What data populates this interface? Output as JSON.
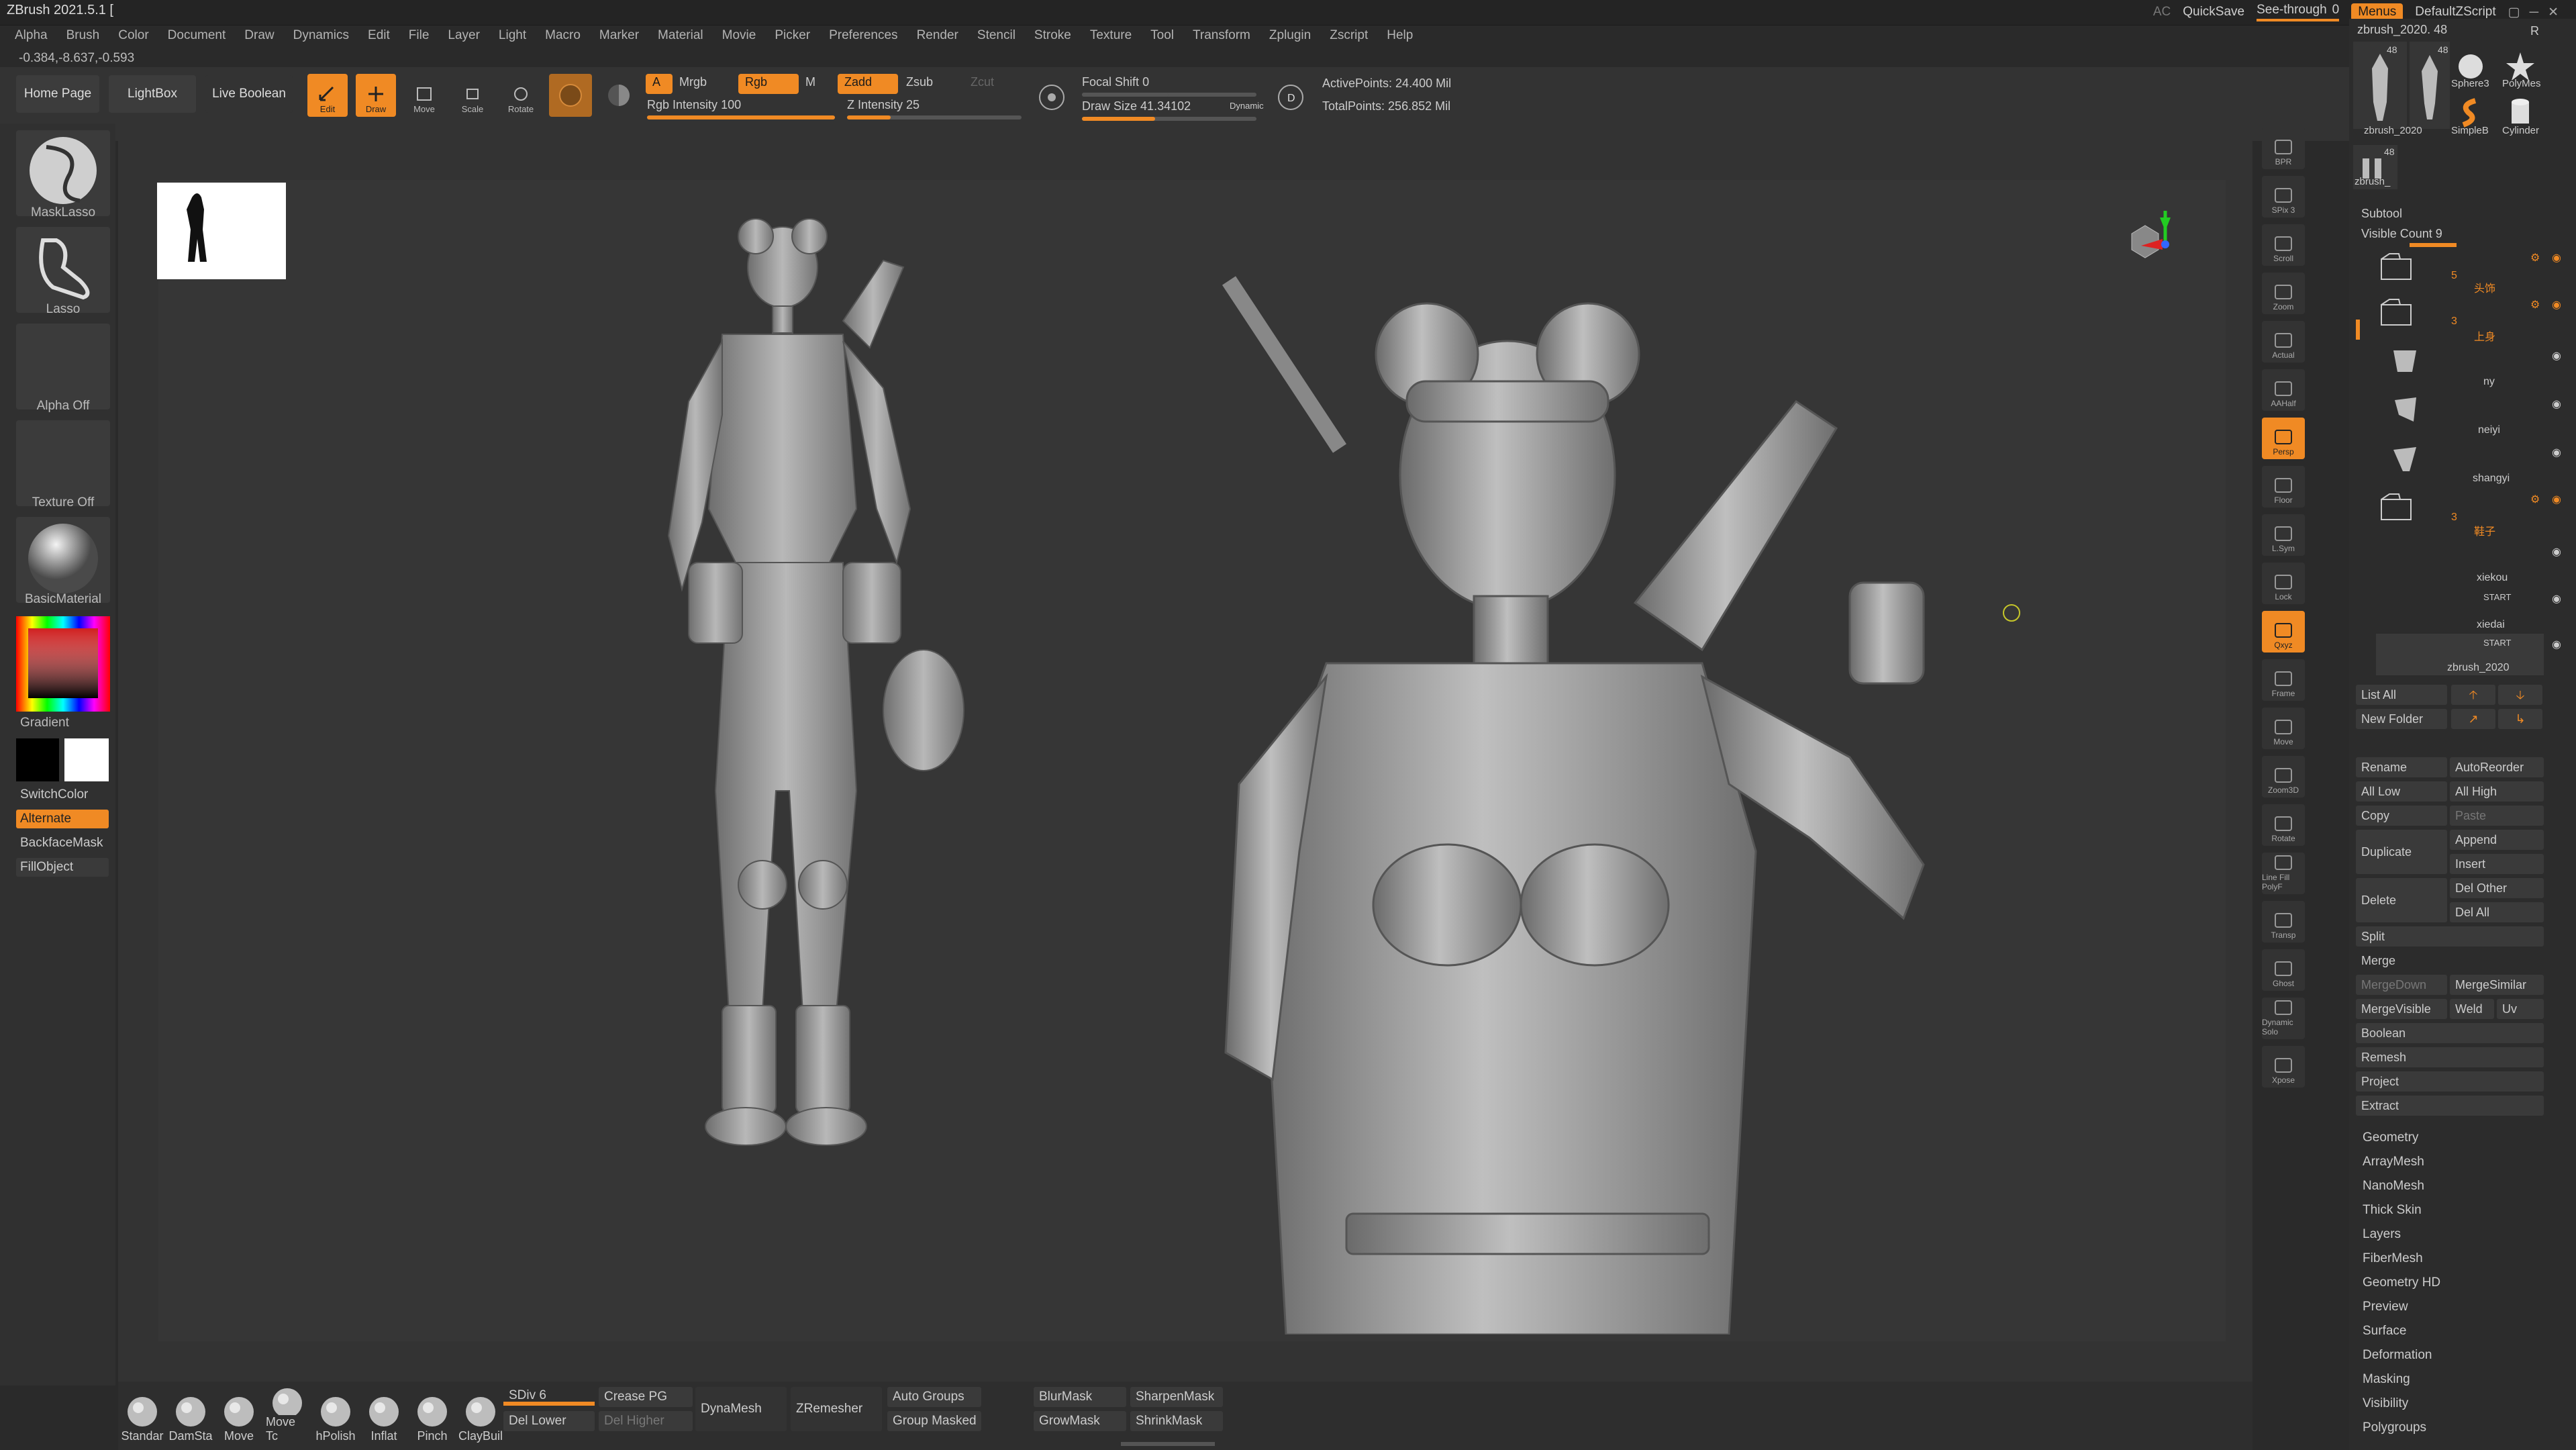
{
  "app": {
    "title": "ZBrush 2021.5.1 [",
    "coords": "-0.384,-8.637,-0.593"
  },
  "menu_items": [
    "Alpha",
    "Brush",
    "Color",
    "Document",
    "Draw",
    "Dynamics",
    "Edit",
    "File",
    "Layer",
    "Light",
    "Macro",
    "Marker",
    "Material",
    "Movie",
    "Picker",
    "Preferences",
    "Render",
    "Stencil",
    "Stroke",
    "Texture",
    "Tool",
    "Transform",
    "Zplugin",
    "Zscript",
    "Help"
  ],
  "topright": {
    "ac": "AC",
    "quicksave": "QuickSave",
    "see_through": "See-through",
    "see_through_value": "0",
    "menus": "Menus",
    "script": "DefaultZScript"
  },
  "toolbar": {
    "home_page": "Home Page",
    "lightbox": "LightBox",
    "live_boolean": "Live Boolean",
    "edit": "Edit",
    "draw": "Draw",
    "move": "Move",
    "scale": "Scale",
    "rotate": "Rotate",
    "a": "A",
    "mrgb": "Mrgb",
    "rgb": "Rgb",
    "m": "M",
    "rgb_intensity_label": "Rgb Intensity",
    "rgb_intensity": "100",
    "zadd": "Zadd",
    "zsub": "Zsub",
    "zcut": "Zcut",
    "z_intensity_label": "Z Intensity",
    "z_intensity": "25",
    "focal_shift_label": "Focal Shift",
    "focal_shift": "0",
    "draw_size_label": "Draw Size",
    "draw_size": "41.34102",
    "dynamic": "Dynamic",
    "active_points": "ActivePoints: 24.400 Mil",
    "total_points": "TotalPoints: 256.852 Mil"
  },
  "left_shelf": {
    "masklasso": "MaskLasso",
    "lasso": "Lasso",
    "alpha_off": "Alpha Off",
    "texture_off": "Texture Off",
    "material": "BasicMaterial",
    "gradient": "Gradient",
    "switchcolor": "SwitchColor",
    "alternate": "Alternate",
    "backfacemask": "BackfaceMask",
    "fillobject": "FillObject"
  },
  "right_tools": [
    "BPR",
    "SPix 3",
    "Scroll",
    "Zoom",
    "Actual",
    "AAHalf",
    "Persp",
    "Floor",
    "L.Sym",
    "Lock",
    "Qxyz",
    "Frame",
    "Move",
    "Zoom3D",
    "Rotate",
    "Line Fill PolyF",
    "Transp",
    "Ghost",
    "Dynamic Solo",
    "Xpose"
  ],
  "right_panel": {
    "tool_name": "zbrush_2020. 48",
    "r": "R",
    "thumb_count_1": "48",
    "thumb_count_2": "48",
    "sphere3": "Sphere3",
    "polymesh": "PolyMes",
    "simpleb": "SimpleB",
    "cylinder": "Cylinder",
    "thumb_label_1": "zbrush_2020",
    "thumb_label_2": "zbrush_",
    "subtool": "Subtool",
    "visible_count": "Visible Count 9",
    "folder1_count": "5",
    "folder1_name": "头饰",
    "folder2_count": "3",
    "folder2_name": "上身",
    "sub_ny": "ny",
    "sub_neiyi": "neiyi",
    "sub_shangyi": "shangyi",
    "folder3_count": "3",
    "folder3_name": "鞋子",
    "sub_xiekou": "xiekou",
    "sub_xiedai": "xiedai",
    "start1": "START",
    "start2": "START",
    "sub_last": "zbrush_2020",
    "list_all": "List All",
    "new_folder": "New Folder",
    "rename": "Rename",
    "autoreorder": "AutoReorder",
    "all_low": "All Low",
    "all_high": "All High",
    "copy": "Copy",
    "paste": "Paste",
    "duplicate": "Duplicate",
    "append": "Append",
    "insert": "Insert",
    "delete": "Delete",
    "del_other": "Del Other",
    "del_all": "Del All",
    "split": "Split",
    "merge": "Merge",
    "mergedown": "MergeDown",
    "mergesimilar": "MergeSimilar",
    "mergevisible": "MergeVisible",
    "weld": "Weld",
    "uv": "Uv",
    "boolean": "Boolean",
    "remesh": "Remesh",
    "project": "Project",
    "extract": "Extract"
  },
  "tool_menus": [
    "Geometry",
    "ArrayMesh",
    "NanoMesh",
    "Thick Skin",
    "Layers",
    "FiberMesh",
    "Geometry HD",
    "Preview",
    "Surface",
    "Deformation",
    "Masking",
    "Visibility",
    "Polygroups"
  ],
  "bottom_shelf": {
    "brushes": [
      "Standar",
      "DamSta",
      "Move",
      "Move Tc",
      "hPolish",
      "Inflat",
      "Pinch",
      "ClayBuil"
    ],
    "sdiv_label": "SDiv",
    "sdiv": "6",
    "del_lower": "Del Lower",
    "crease_pg": "Crease PG",
    "del_higher": "Del Higher",
    "dynamesh": "DynaMesh",
    "zremesher": "ZRemesher",
    "auto_groups": "Auto Groups",
    "group_masked": "Group Masked",
    "blurmask": "BlurMask",
    "growmask": "GrowMask",
    "sharpenmask": "SharpenMask",
    "shrinkmask": "ShrinkMask"
  },
  "colors": {
    "accent": "#f08a24",
    "background": "#2a2a2a",
    "panel": "#2c2c2c"
  }
}
